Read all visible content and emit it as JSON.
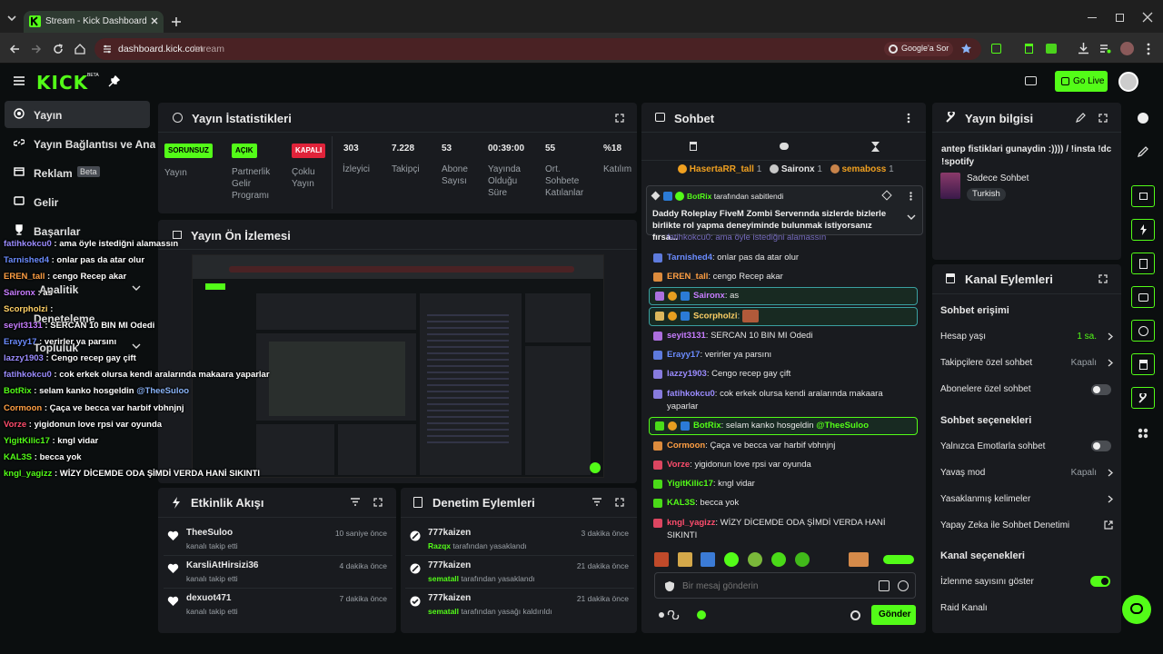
{
  "browser": {
    "tab_title": "Stream - Kick Dashboard",
    "url_domain": "dashboard.kick.com",
    "url_path": "/stream",
    "google_button": "Google'a Sor"
  },
  "header": {
    "logo": "KICK",
    "logo_badge": "BETA",
    "go_live": "Go Live"
  },
  "sidebar": {
    "items": [
      {
        "label": "Yayın"
      },
      {
        "label": "Yayın Bağlantısı ve Anahtarı"
      },
      {
        "label": "Reklam",
        "badge": "Beta"
      },
      {
        "label": "Gelir"
      },
      {
        "label": "Başarılar"
      },
      {
        "label": "Analitik"
      },
      {
        "label": "Deneteleme"
      },
      {
        "label": "Topluluk"
      }
    ]
  },
  "stats": {
    "title": "Yayın İstatistikleri",
    "items": [
      {
        "badge": "SORUNSUZ",
        "label": "Yayın"
      },
      {
        "badge": "AÇIK",
        "label": "Partnerlik Gelir Programı"
      },
      {
        "badge": "KAPALI",
        "label": "Çoklu Yayın"
      },
      {
        "value": "303",
        "label": "İzleyici"
      },
      {
        "value": "7.228",
        "label": "Takipçi"
      },
      {
        "value": "53",
        "label": "Abone Sayısı"
      },
      {
        "value": "00:39:00",
        "label": "Yayında Olduğu Süre"
      },
      {
        "value": "55",
        "label": "Ort. Sohbete Katılanlar"
      },
      {
        "value": "%18",
        "label": "Katılım"
      }
    ]
  },
  "preview": {
    "title": "Yayın Ön İzlemesi"
  },
  "overlay_chat": [
    {
      "user": "fatihkokcu0",
      "text": " : ama öyle istediğni alamassın",
      "color": "#9b8cff"
    },
    {
      "user": "Tarnished4",
      "text": " : onlar pas da atar olur",
      "color": "#6b8cff"
    },
    {
      "user": "EREN_tall",
      "text": " : cengo Recep akar",
      "color": "#ff9f43"
    },
    {
      "user": "Saironx",
      "text": " : as",
      "color": "#c77dff"
    },
    {
      "user": "Scorpholzi",
      "text": " : ",
      "color": "#ffd166"
    },
    {
      "user": "seyit3131",
      "text": " : SERCAN 10 BIN MI Odedi",
      "color": "#c77dff"
    },
    {
      "user": "Erayy17",
      "text": " : verirler ya parsını",
      "color": "#6b8cff"
    },
    {
      "user": "lazzy1903",
      "text": " : Cengo recep gay çift",
      "color": "#9b8cff"
    },
    {
      "user": "fatihkokcu0",
      "text": " : cok erkek olursa kendi aralarında makaara yaparlar",
      "color": "#9b8cff"
    },
    {
      "user": "BotRix",
      "text": " : selam kanko hosgeldin ",
      "mention": "@TheeSuloo",
      "color": "#53fc18"
    },
    {
      "user": "Cormoon",
      "text": " : Çaça ve becca var harbif vbhnjnj",
      "color": "#ff9f43"
    },
    {
      "user": "Vorze",
      "text": " : yigidonun love rpsi var oyunda",
      "color": "#ff4d6d"
    },
    {
      "user": "YigitKilic17",
      "text": " : kngl vidar",
      "color": "#53fc18"
    },
    {
      "user": "KAL3S",
      "text": " : becca yok",
      "color": "#53fc18"
    },
    {
      "user": "kngl_yagizz",
      "text": " : WİZY DİCEMDE ODA ŞİMDİ VERDA HANİ SIKINTI",
      "color": "#53fc18"
    }
  ],
  "activity": {
    "title": "Etkinlik Akışı",
    "items": [
      {
        "user": "TheeSuloo",
        "sub": "kanalı takip etti",
        "time": "10 saniye önce"
      },
      {
        "user": "KarsliAtHirsizi36",
        "sub": "kanalı takip etti",
        "time": "4 dakika önce"
      },
      {
        "user": "dexuot471",
        "sub": "kanalı takip etti",
        "time": "7 dakika önce"
      }
    ]
  },
  "moderation": {
    "title": "Denetim Eylemleri",
    "items": [
      {
        "user": "777kaizen",
        "actor": "Razqx",
        "sub": " tarafından yasaklandı",
        "time": "3 dakika önce"
      },
      {
        "user": "777kaizen",
        "actor": "sematall",
        "sub": " tarafından yasaklandı",
        "time": "21 dakika önce"
      },
      {
        "user": "777kaizen",
        "actor": "sematall",
        "sub": " tarafından yasağı kaldırıldı",
        "time": "21 dakika önce"
      }
    ]
  },
  "chat": {
    "title": "Sohbet",
    "top_gifters": [
      {
        "name": "HasertaRR_tall",
        "count": "1"
      },
      {
        "name": "Saironx",
        "count": "1"
      },
      {
        "name": "semaboss",
        "count": "1"
      }
    ],
    "pinned_by_user": "BotRix",
    "pinned_by_suffix": " tarafından sabitlendi",
    "pinned_text": "Daddy Roleplay FiveM Zombi Serverında sizlerde bizlerle birlikte rol yapma deneyiminde bulunmak istiyorsanız fırsa...",
    "partial_line": "fatihkokcu0: ama öyle istediğni alamassın",
    "messages": [
      {
        "user": "Tarnished4",
        "text": ": onlar pas da atar olur",
        "color": "#6b8cff"
      },
      {
        "user": "EREN_tall",
        "text": ": cengo Recep akar",
        "color": "#ff9f43"
      },
      {
        "user": "Saironx",
        "text": ": as",
        "color": "#c77dff"
      },
      {
        "user": "Scorpholzi",
        "text": ": ",
        "color": "#ffd166"
      },
      {
        "user": "seyit3131",
        "text": ": SERCAN 10 BIN MI Odedi",
        "color": "#c77dff"
      },
      {
        "user": "Erayy17",
        "text": ": verirler ya parsını",
        "color": "#6b8cff"
      },
      {
        "user": "lazzy1903",
        "text": ": Cengo recep gay çift",
        "color": "#9b8cff"
      },
      {
        "user": "fatihkokcu0",
        "text": ": cok erkek olursa kendi aralarında makaara yaparlar",
        "color": "#9b8cff"
      },
      {
        "user": "BotRix",
        "text": ": selam kanko hosgeldin ",
        "mention": "@TheeSuloo",
        "color": "#53fc18"
      },
      {
        "user": "Cormoon",
        "text": ": Çaça ve becca var harbif vbhnjnj",
        "color": "#ff9f43"
      },
      {
        "user": "Vorze",
        "text": ": yigidonun love rpsi var oyunda",
        "color": "#ff4d6d"
      },
      {
        "user": "YigitKilic17",
        "text": ": kngl vidar",
        "color": "#53fc18"
      },
      {
        "user": "KAL3S",
        "text": ": becca yok",
        "color": "#53fc18"
      },
      {
        "user": "kngl_yagizz",
        "text": ": WİZY DİCEMDE ODA ŞİMDİ VERDA HANİ SIKINTI",
        "color": "#ff4d6d"
      }
    ],
    "input_placeholder": "Bir mesaj gönderin",
    "send": "Gönder"
  },
  "info": {
    "title": "Yayın bilgisi",
    "stream_title": "antep fistiklari gunaydin :)))) / !insta !dc !spotify",
    "category": "Sadece Sohbet",
    "tag": "Turkish"
  },
  "channel_actions": {
    "title": "Kanal Eylemleri",
    "sections": [
      {
        "heading": "Sohbet erişimi",
        "rows": [
          {
            "label": "Hesap yaşı",
            "value": "1 sa.",
            "value_color": "#53fc18",
            "type": "link"
          },
          {
            "label": "Takipçilere özel sohbet",
            "value": "Kapalı",
            "type": "link"
          },
          {
            "label": "Abonelere özel sohbet",
            "type": "toggle",
            "on": false
          }
        ]
      },
      {
        "heading": "Sohbet seçenekleri",
        "rows": [
          {
            "label": "Yalnızca Emotlarla sohbet",
            "type": "toggle",
            "on": false
          },
          {
            "label": "Yavaş mod",
            "value": "Kapalı",
            "type": "link"
          },
          {
            "label": "Yasaklanmış kelimeler",
            "type": "link"
          },
          {
            "label": "Yapay Zeka ile Sohbet Denetimi",
            "type": "external"
          }
        ]
      },
      {
        "heading": "Kanal seçenekleri",
        "rows": [
          {
            "label": "İzlenme sayısını göster",
            "type": "toggle",
            "on": true
          },
          {
            "label": "Raid Kanalı",
            "type": "link"
          }
        ]
      }
    ]
  },
  "colors": {
    "accent": "#53fc18",
    "bg": "#0b0e0f",
    "panel": "#191b1f"
  }
}
